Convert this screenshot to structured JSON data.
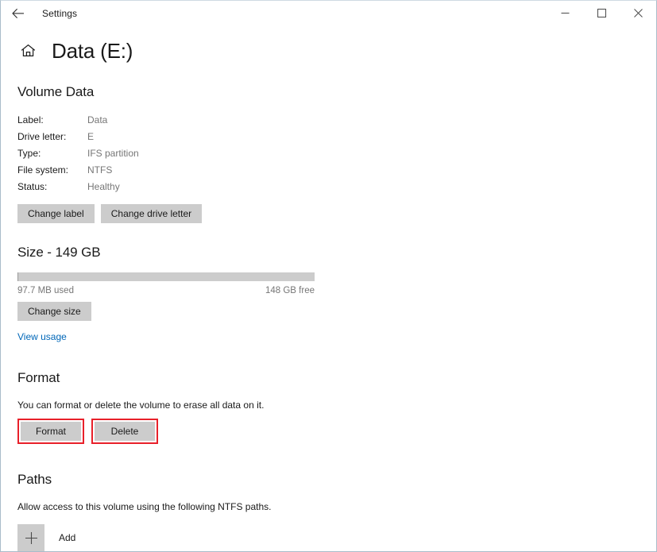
{
  "window": {
    "app_title": "Settings",
    "back_icon": "back-arrow-icon",
    "minimize_icon": "minimize-icon",
    "maximize_icon": "maximize-icon",
    "close_icon": "close-icon"
  },
  "page": {
    "home_icon": "home-icon",
    "title": "Data (E:)"
  },
  "volume_data": {
    "heading": "Volume Data",
    "rows": [
      {
        "key": "Label:",
        "value": "Data"
      },
      {
        "key": "Drive letter:",
        "value": "E"
      },
      {
        "key": "Type:",
        "value": "IFS partition"
      },
      {
        "key": "File system:",
        "value": "NTFS"
      },
      {
        "key": "Status:",
        "value": "Healthy"
      }
    ],
    "change_label_button": "Change label",
    "change_drive_letter_button": "Change drive letter"
  },
  "size": {
    "heading": "Size - 149 GB",
    "used_label": "97.7 MB used",
    "free_label": "148 GB free",
    "used_percent": 0.07,
    "change_size_button": "Change size",
    "view_usage_link": "View usage"
  },
  "format": {
    "heading": "Format",
    "description": "You can format or delete the volume to erase all data on it.",
    "format_button": "Format",
    "delete_button": "Delete",
    "highlight_color": "#e8202a"
  },
  "paths": {
    "heading": "Paths",
    "description": "Allow access to this volume using the following NTFS paths.",
    "add_icon": "plus-icon",
    "add_label": "Add"
  }
}
